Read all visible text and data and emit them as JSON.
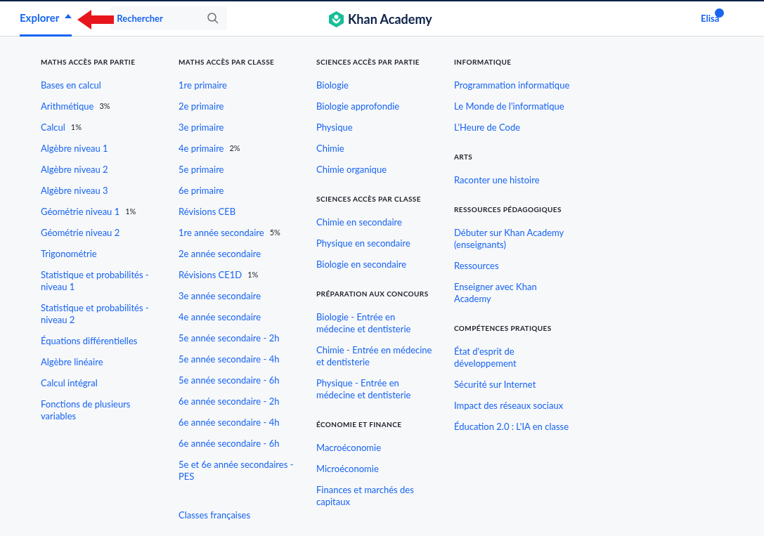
{
  "header": {
    "explore_tab": {
      "label": "Explorer",
      "selected": true,
      "expanded": true
    },
    "search": {
      "placeholder": "Rechercher"
    },
    "logo": {
      "text": "Khan Academy"
    },
    "user": {
      "name": "Elisa",
      "notification": true
    }
  },
  "columns": [
    {
      "sections": [
        {
          "heading": "MATHS ACCÈS PAR PARTIE",
          "items": [
            {
              "label": "Bases en calcul"
            },
            {
              "label": "Arithmétique",
              "progress": "3%"
            },
            {
              "label": "Calcul",
              "progress": "1%"
            },
            {
              "label": "Algèbre niveau 1"
            },
            {
              "label": "Algèbre niveau 2"
            },
            {
              "label": "Algèbre niveau 3"
            },
            {
              "label": "Géométrie niveau 1",
              "progress": "1%"
            },
            {
              "label": "Géométrie niveau 2"
            },
            {
              "label": "Trigonométrie"
            },
            {
              "label": "Statistique et probabilités - niveau 1"
            },
            {
              "label": "Statistique et probabilités - niveau 2"
            },
            {
              "label": "Équations différentielles"
            },
            {
              "label": "Algèbre linéaire"
            },
            {
              "label": "Calcul intégral"
            },
            {
              "label": "Fonctions de plusieurs variables"
            }
          ]
        }
      ]
    },
    {
      "sections": [
        {
          "heading": "MATHS ACCÈS PAR CLASSE",
          "items": [
            {
              "label": "1re primaire"
            },
            {
              "label": "2e primaire"
            },
            {
              "label": "3e primaire"
            },
            {
              "label": "4e primaire",
              "progress": "2%"
            },
            {
              "label": "5e primaire"
            },
            {
              "label": "6e primaire"
            },
            {
              "label": "Révisions CEB"
            },
            {
              "label": "1re année secondaire",
              "progress": "5%"
            },
            {
              "label": "2e année secondaire"
            },
            {
              "label": "Révisions CE1D",
              "progress": "1%"
            },
            {
              "label": "3e année secondaire"
            },
            {
              "label": "4e année secondaire"
            },
            {
              "label": "5e année secondaire - 2h"
            },
            {
              "label": "5e année secondaire - 4h"
            },
            {
              "label": "5e année secondaire - 6h"
            },
            {
              "label": "6e année secondaire - 2h"
            },
            {
              "label": "6e année secondaire - 4h"
            },
            {
              "label": "6e année secondaire - 6h"
            },
            {
              "label": "5e et 6e année secondaires - PES"
            }
          ]
        },
        {
          "items": [
            {
              "label": "Classes françaises"
            }
          ]
        }
      ]
    },
    {
      "sections": [
        {
          "heading": "SCIENCES ACCÈS PAR PARTIE",
          "items": [
            {
              "label": "Biologie"
            },
            {
              "label": "Biologie approfondie"
            },
            {
              "label": "Physique"
            },
            {
              "label": "Chimie"
            },
            {
              "label": "Chimie organique"
            }
          ]
        },
        {
          "heading": "SCIENCES ACCÈS PAR CLASSE",
          "items": [
            {
              "label": "Chimie en secondaire"
            },
            {
              "label": "Physique en secondaire"
            },
            {
              "label": "Biologie en secondaire"
            }
          ]
        },
        {
          "heading": "PRÉPARATION AUX CONCOURS",
          "items": [
            {
              "label": "Biologie - Entrée en médecine et dentisterie"
            },
            {
              "label": "Chimie - Entrée en médecine et dentisterie"
            },
            {
              "label": "Physique - Entrée en médecine et dentisterie"
            }
          ]
        },
        {
          "heading": "ÉCONOMIE ET FINANCE",
          "items": [
            {
              "label": "Macroéconomie"
            },
            {
              "label": "Microéconomie"
            },
            {
              "label": "Finances et marchés des capitaux"
            }
          ]
        }
      ]
    },
    {
      "sections": [
        {
          "heading": "INFORMATIQUE",
          "items": [
            {
              "label": "Programmation informatique"
            },
            {
              "label": "Le Monde de l'informatique"
            },
            {
              "label": "L'Heure de Code"
            }
          ]
        },
        {
          "heading": "ARTS",
          "items": [
            {
              "label": "Raconter une histoire"
            }
          ]
        },
        {
          "heading": "RESSOURCES PÉDAGOGIQUES",
          "items": [
            {
              "label": "Débuter sur Khan Academy (enseignants)"
            },
            {
              "label": "Ressources"
            },
            {
              "label": "Enseigner avec Khan Academy"
            }
          ]
        },
        {
          "heading": "COMPÉTENCES PRATIQUES",
          "items": [
            {
              "label": "État d'esprit de développement"
            },
            {
              "label": "Sécurité sur Internet"
            },
            {
              "label": "Impact des réseaux sociaux"
            },
            {
              "label": "Éducation 2.0 : L'IA en classe"
            }
          ]
        }
      ]
    }
  ]
}
